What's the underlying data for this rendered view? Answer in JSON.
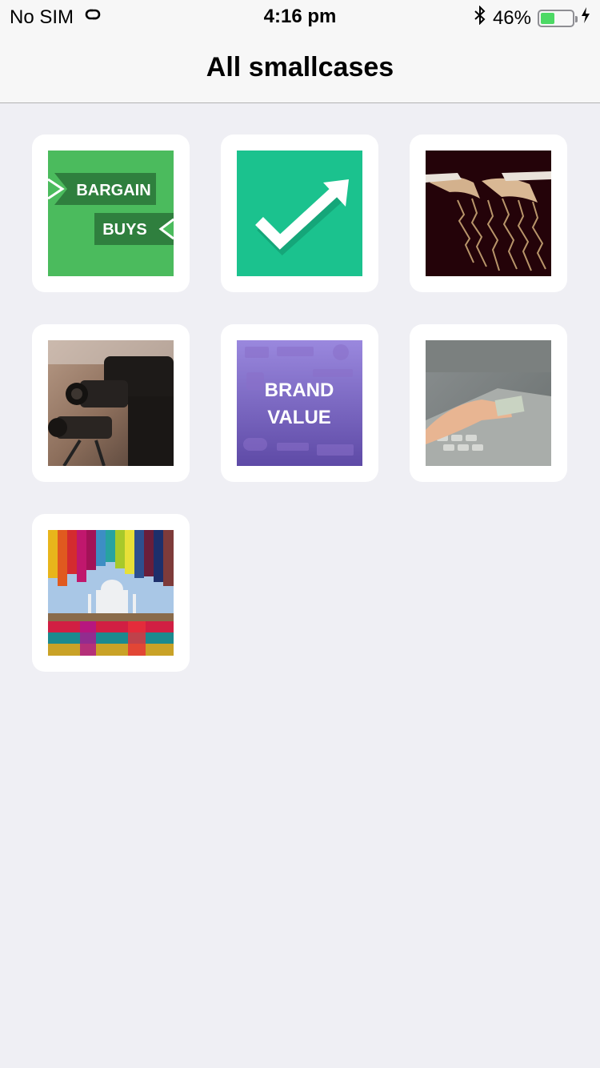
{
  "status_bar": {
    "carrier": "No SIM",
    "time": "4:16 pm",
    "battery_percent": "46%",
    "battery_level": 0.46
  },
  "nav": {
    "title": "All smallcases"
  },
  "tiles": [
    {
      "name": "bargain-buys",
      "text_line1": "BARGAIN",
      "text_line2": "BUYS",
      "icon": "bargain-buys-image"
    },
    {
      "name": "checkmark-arrow",
      "icon": "checkmark-arrow-image"
    },
    {
      "name": "hands-lightning",
      "icon": "hands-lightning-image"
    },
    {
      "name": "cameras",
      "icon": "video-cameras-image"
    },
    {
      "name": "brand-value",
      "text_line1": "BRAND",
      "text_line2": "VALUE",
      "icon": "brand-value-image"
    },
    {
      "name": "atm",
      "icon": "atm-card-image"
    },
    {
      "name": "india-colors",
      "icon": "taj-mahal-threads-image"
    }
  ],
  "colors": {
    "background": "#efeff4",
    "bargain_green": "#4bbb5d",
    "check_teal": "#1bc28e",
    "brand_purple": "#7d6ac9"
  }
}
